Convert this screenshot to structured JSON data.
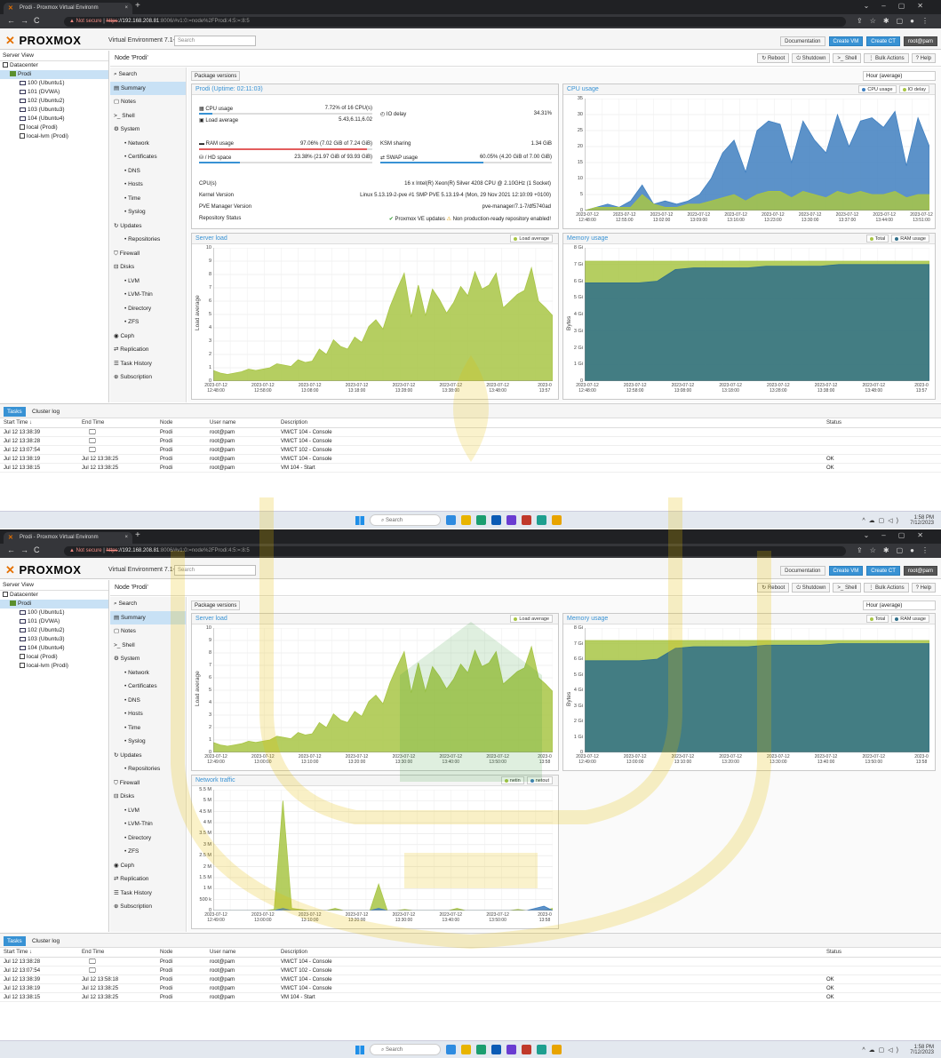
{
  "browser": {
    "tab_title": "Prodi - Proxmox Virtual Environm",
    "not_secure": "Not secure",
    "url_scheme": "https",
    "url_host": "://192.168.208.81",
    "url_path": ":8006/#v1:0:=node%2FProdi:4:5:=:8:5"
  },
  "header": {
    "logo": "PROXMOX",
    "product": "Virtual Environment 7.1-7",
    "search_placeholder": "Search",
    "documentation": "Documentation",
    "create_vm": "Create VM",
    "create_ct": "Create CT",
    "user": "root@pam"
  },
  "sidebar": {
    "view": "Server View",
    "datacenter": "Datacenter",
    "node": "Prodi",
    "vms": [
      "100 (Ubuntu1)",
      "101 (DVWA)",
      "102 (Ubuntu2)",
      "103 (Ubuntu3)",
      "104 (Ubuntu4)"
    ],
    "storage": [
      "local (Prodi)",
      "local-lvm (Prodi)"
    ]
  },
  "node_toolbar": {
    "title": "Node 'Prodi'",
    "reboot": "Reboot",
    "shutdown": "Shutdown",
    "shell": "Shell",
    "bulk": "Bulk Actions",
    "help": "Help"
  },
  "menu": {
    "items": [
      "Search",
      "Summary",
      "Notes",
      "Shell",
      "System",
      "Network",
      "Certificates",
      "DNS",
      "Hosts",
      "Time",
      "Syslog",
      "Updates",
      "Repositories",
      "Firewall",
      "Disks",
      "LVM",
      "LVM-Thin",
      "Directory",
      "ZFS",
      "Ceph",
      "Replication",
      "Task History",
      "Subscription"
    ]
  },
  "content": {
    "package_versions": "Package versions",
    "range": "Hour (average)"
  },
  "status": {
    "title": "Prodi (Uptime: 02:11:03)",
    "cpu_label": "CPU usage",
    "cpu_value": "7.72% of 16 CPU(s)",
    "cpu_pct": 7.72,
    "io_label": "IO delay",
    "io_value": "34.31%",
    "load_label": "Load average",
    "load_value": "5.43,6.11,6.02",
    "ram_label": "RAM usage",
    "ram_value": "97.06% (7.02 GiB of 7.24 GiB)",
    "ram_pct": 97.06,
    "ksm_label": "KSM sharing",
    "ksm_value": "1.34 GiB",
    "hd_label": "/ HD space",
    "hd_value": "23.38% (21.97 GiB of 93.93 GiB)",
    "hd_pct": 23.38,
    "swap_label": "SWAP usage",
    "swap_value": "60.05% (4.20 GiB of 7.00 GiB)",
    "swap_pct": 60.05,
    "cpus_label": "CPU(s)",
    "cpus_value": "16 x Intel(R) Xeon(R) Silver 4208 CPU @ 2.10GHz (1 Socket)",
    "kernel_label": "Kernel Version",
    "kernel_value": "Linux 5.13.19-2-pve #1 SMP PVE 5.13.19-4 (Mon, 29 Nov 2021 12:10:09 +0100)",
    "pve_label": "PVE Manager Version",
    "pve_value": "pve-manager/7.1-7/df5740ad",
    "repo_label": "Repository Status",
    "repo_value": "Proxmox VE updates",
    "repo_warn": "Non production-ready repository enabled!"
  },
  "charts": {
    "cpu": {
      "title": "CPU usage",
      "legend": [
        "CPU usage",
        "IO delay"
      ],
      "yticks": [
        "35",
        "30",
        "25",
        "20",
        "15",
        "10",
        "5",
        "0"
      ]
    },
    "load": {
      "title": "Server load",
      "legend": [
        "Load average"
      ],
      "ylabel": "Load average",
      "yticks": [
        "10",
        "9",
        "8",
        "7",
        "6",
        "5",
        "4",
        "3",
        "2",
        "1",
        "0"
      ]
    },
    "mem": {
      "title": "Memory usage",
      "legend": [
        "Total",
        "RAM usage"
      ],
      "ylabel": "Bytes",
      "yticks": [
        "8 Gi",
        "7 Gi",
        "6 Gi",
        "5 Gi",
        "4 Gi",
        "3 Gi",
        "2 Gi",
        "1 Gi",
        "0"
      ]
    },
    "net": {
      "title": "Network traffic",
      "legend": [
        "netin",
        "netout"
      ],
      "yticks": [
        "5.5 M",
        "5 M",
        "4.5 M",
        "4 M",
        "3.5 M",
        "3 M",
        "2.5 M",
        "2 M",
        "1.5 M",
        "1 M",
        "500 k",
        "0"
      ]
    },
    "cpu_x": [
      "2023-07-12\n12:48:00",
      "2023-07-12\n12:55:00",
      "2023-07-12\n13:02:00",
      "2023-07-12\n13:09:00",
      "2023-07-12\n13:16:00",
      "2023-07-12\n13:23:00",
      "2023-07-12\n13:30:00",
      "2023-07-12\n13:37:00",
      "2023-07-12\n13:44:00",
      "2023-07-12\n13:51:00"
    ],
    "load_x1": [
      "2023-07-12\n12:48:00",
      "2023-07-12\n12:58:00",
      "2023-07-12\n13:08:00",
      "2023-07-12\n13:18:00",
      "2023-07-12\n13:28:00",
      "2023-07-12\n13:38:00",
      "2023-07-12\n13:48:00",
      "2023-0\n13:57"
    ],
    "x2": [
      "2023-07-12\n12:49:00",
      "2023-07-12\n13:00:00",
      "2023-07-12\n13:10:00",
      "2023-07-12\n13:20:00",
      "2023-07-12\n13:30:00",
      "2023-07-12\n13:40:00",
      "2023-07-12\n13:50:00",
      "2023-0\n13:58"
    ]
  },
  "chart_data": [
    {
      "type": "area",
      "title": "CPU usage",
      "series": [
        {
          "name": "CPU usage",
          "values": [
            0,
            1,
            2,
            1,
            3,
            8,
            2,
            3,
            2,
            3,
            5,
            10,
            18,
            22,
            12,
            25,
            28,
            27,
            15,
            28,
            22,
            18,
            30,
            20,
            28,
            29,
            26,
            31,
            14,
            29,
            20
          ]
        },
        {
          "name": "IO delay",
          "values": [
            0,
            1,
            1,
            1,
            1,
            5,
            2,
            1,
            1,
            2,
            2,
            3,
            4,
            5,
            3,
            5,
            6,
            6,
            4,
            6,
            5,
            4,
            6,
            5,
            6,
            5,
            5,
            6,
            4,
            5,
            5
          ]
        }
      ],
      "ylim": [
        0,
        35
      ]
    },
    {
      "type": "area",
      "title": "Server load",
      "ylabel": "Load average",
      "series": [
        {
          "name": "Load average",
          "values": [
            0.8,
            0.6,
            0.5,
            0.6,
            0.7,
            0.9,
            0.8,
            0.9,
            1.0,
            1.3,
            1.2,
            1.1,
            1.6,
            1.4,
            1.5,
            2.4,
            2.0,
            3.1,
            2.6,
            2.4,
            3.3,
            2.9,
            4.1,
            4.6,
            3.9,
            5.6,
            6.9,
            8.1,
            4.8,
            7.2,
            4.9,
            6.9,
            6.1,
            5.1,
            5.9,
            7.1,
            6.4,
            8.2,
            6.9,
            7.2,
            8.1,
            5.5,
            6.0,
            6.5,
            6.8,
            8.5,
            6.0,
            5.5,
            4.9
          ]
        }
      ],
      "ylim": [
        0,
        10
      ]
    },
    {
      "type": "area",
      "title": "Memory usage",
      "ylabel": "Bytes",
      "series": [
        {
          "name": "Total",
          "values": [
            7.2,
            7.2,
            7.2,
            7.2,
            7.2,
            7.2,
            7.2,
            7.2,
            7.2,
            7.2,
            7.2,
            7.2,
            7.2,
            7.2,
            7.2,
            7.2,
            7.2,
            7.2,
            7.2,
            7.2
          ]
        },
        {
          "name": "RAM usage",
          "values": [
            5.9,
            5.9,
            5.9,
            5.9,
            6.0,
            6.7,
            6.8,
            6.8,
            6.8,
            6.8,
            6.9,
            6.9,
            6.9,
            6.9,
            7.0,
            7.0,
            7.0,
            7.0,
            7.0,
            7.0
          ]
        }
      ],
      "ylim": [
        0,
        8
      ]
    },
    {
      "type": "area",
      "title": "Network traffic",
      "series": [
        {
          "name": "netin",
          "values": [
            0,
            0,
            0,
            0,
            0,
            0,
            0,
            0.05,
            5.0,
            0.1,
            0.05,
            0,
            0,
            0,
            0.1,
            0,
            0,
            0,
            0,
            1.2,
            0,
            0,
            0.05,
            0,
            0,
            0,
            0,
            0,
            0.1,
            0,
            0,
            0,
            0,
            0,
            0,
            0.05,
            0,
            0,
            0,
            0.1
          ]
        },
        {
          "name": "netout",
          "values": [
            0,
            0,
            0,
            0,
            0,
            0,
            0,
            0,
            0.1,
            0,
            0,
            0,
            0,
            0,
            0,
            0,
            0,
            0,
            0,
            0.1,
            0,
            0,
            0,
            0,
            0,
            0,
            0,
            0,
            0,
            0,
            0,
            0,
            0,
            0,
            0,
            0,
            0,
            0.1,
            0.2,
            0
          ]
        }
      ],
      "ylim": [
        0,
        5.5
      ]
    }
  ],
  "tasks": {
    "tab_tasks": "Tasks",
    "tab_cluster": "Cluster log",
    "headers": [
      "Start Time ↓",
      "End Time",
      "Node",
      "User name",
      "Description",
      "Status"
    ],
    "rows1": [
      [
        "Jul 12 13:38:39",
        "",
        "Prodi",
        "root@pam",
        "VM/CT 104 - Console",
        ""
      ],
      [
        "Jul 12 13:38:28",
        "",
        "Prodi",
        "root@pam",
        "VM/CT 104 - Console",
        ""
      ],
      [
        "Jul 12 13:07:54",
        "",
        "Prodi",
        "root@pam",
        "VM/CT 102 - Console",
        ""
      ],
      [
        "Jul 12 13:38:19",
        "Jul 12 13:38:25",
        "Prodi",
        "root@pam",
        "VM/CT 104 - Console",
        "OK"
      ],
      [
        "Jul 12 13:38:15",
        "Jul 12 13:38:25",
        "Prodi",
        "root@pam",
        "VM 104 - Start",
        "OK"
      ]
    ],
    "rows2": [
      [
        "Jul 12 13:38:28",
        "",
        "Prodi",
        "root@pam",
        "VM/CT 104 - Console",
        ""
      ],
      [
        "Jul 12 13:07:54",
        "",
        "Prodi",
        "root@pam",
        "VM/CT 102 - Console",
        ""
      ],
      [
        "Jul 12 13:38:39",
        "Jul 12 13:58:18",
        "Prodi",
        "root@pam",
        "VM/CT 104 - Console",
        "OK"
      ],
      [
        "Jul 12 13:38:19",
        "Jul 12 13:38:25",
        "Prodi",
        "root@pam",
        "VM/CT 104 - Console",
        "OK"
      ],
      [
        "Jul 12 13:38:15",
        "Jul 12 13:38:25",
        "Prodi",
        "root@pam",
        "VM 104 - Start",
        "OK"
      ]
    ]
  },
  "taskbar": {
    "search": "Search",
    "time": "1:58 PM",
    "date": "7/12/2023"
  },
  "colors": {
    "accent": "#3892d4",
    "load": "#a8c545",
    "cpu": "#3f7fc0",
    "mem_total": "#a8c545",
    "mem_ram": "#2f6f8a",
    "warn": "#e35d5d"
  }
}
